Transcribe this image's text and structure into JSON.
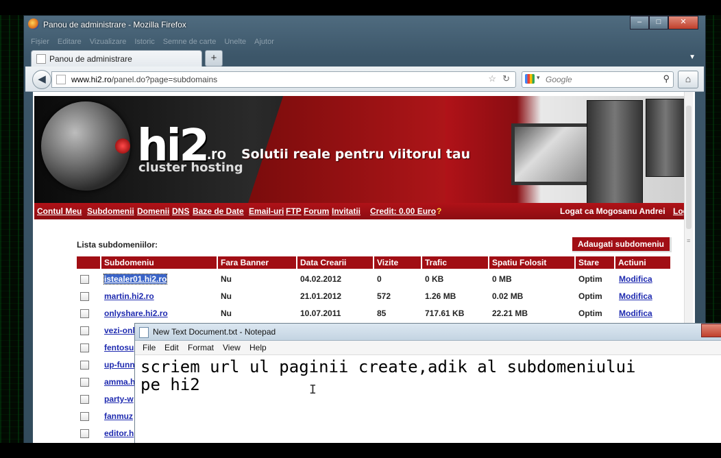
{
  "window": {
    "title": "Panou de administrare - Mozilla Firefox",
    "menu": [
      "Fișier",
      "Editare",
      "Vizualizare",
      "Istoric",
      "Semne de carte",
      "Unelte",
      "Ajutor"
    ]
  },
  "tabs": [
    {
      "label": "Panou de administrare"
    }
  ],
  "newtab_label": "+",
  "address": {
    "host": "www.hi2.ro",
    "path": "/panel.do?page=subdomains"
  },
  "search": {
    "placeholder": "Google"
  },
  "banner": {
    "logo": "hi2",
    "logo_suffix": ".ro",
    "logo_sub": "cluster hosting",
    "slogan": "Solutii reale pentru viitorul tau"
  },
  "nav": {
    "items": [
      "Contul Meu",
      "Subdomenii",
      "Domenii",
      "DNS",
      "Baze de Date",
      "Email-uri",
      "FTP",
      "Forum",
      "Invitatii"
    ],
    "credit": "Credit: 0.00 Euro",
    "credit_help": "?",
    "logged": "Logat ca Mogosanu Andrei",
    "logout": "Logout"
  },
  "subdomains": {
    "title": "Lista subdomeniilor:",
    "add_button": "Adaugati subdomeniu",
    "columns": [
      "Subdomeniu",
      "Fara Banner",
      "Data Crearii",
      "Vizite",
      "Trafic",
      "Spatiu Folosit",
      "Stare",
      "Actiuni"
    ],
    "rows": [
      {
        "name": "istealer01.hi2.ro",
        "banner": "Nu",
        "date": "04.02.2012",
        "visits": "0",
        "traffic": "0 KB",
        "space": "0 MB",
        "state": "Optim",
        "action": "Modifica"
      },
      {
        "name": "martin.hi2.ro",
        "banner": "Nu",
        "date": "21.01.2012",
        "visits": "572",
        "traffic": "1.26 MB",
        "space": "0.02 MB",
        "state": "Optim",
        "action": "Modifica"
      },
      {
        "name": "onlyshare.hi2.ro",
        "banner": "Nu",
        "date": "10.07.2011",
        "visits": "85",
        "traffic": "717.61 KB",
        "space": "22.21 MB",
        "state": "Optim",
        "action": "Modifica"
      },
      {
        "name": "vezi-onl",
        "banner": "",
        "date": "",
        "visits": "",
        "traffic": "",
        "space": "",
        "state": "",
        "action": ""
      },
      {
        "name": "fentosu",
        "banner": "",
        "date": "",
        "visits": "",
        "traffic": "",
        "space": "",
        "state": "",
        "action": ""
      },
      {
        "name": "up-funn",
        "banner": "",
        "date": "",
        "visits": "",
        "traffic": "",
        "space": "",
        "state": "",
        "action": ""
      },
      {
        "name": "amma.h",
        "banner": "",
        "date": "",
        "visits": "",
        "traffic": "",
        "space": "",
        "state": "",
        "action": ""
      },
      {
        "name": "party-w",
        "banner": "",
        "date": "",
        "visits": "",
        "traffic": "",
        "space": "",
        "state": "",
        "action": ""
      },
      {
        "name": "fanmuz",
        "banner": "",
        "date": "",
        "visits": "",
        "traffic": "",
        "space": "",
        "state": "",
        "action": ""
      },
      {
        "name": "editor.h",
        "banner": "",
        "date": "",
        "visits": "",
        "traffic": "",
        "space": "",
        "state": "",
        "action": ""
      }
    ]
  },
  "notepad": {
    "title": "New Text Document.txt - Notepad",
    "menu": [
      "File",
      "Edit",
      "Format",
      "View",
      "Help"
    ],
    "line1": "scriem url ul paginii create,adik al subdomeniului",
    "line2": "pe hi2"
  }
}
